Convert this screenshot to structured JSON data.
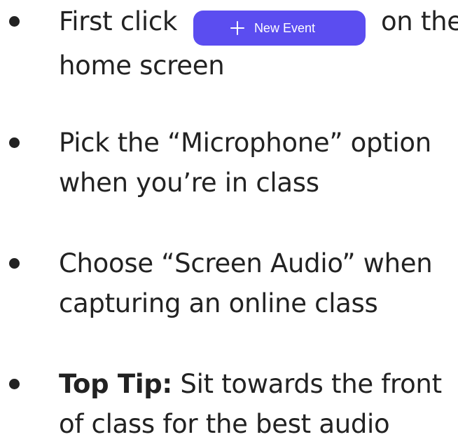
{
  "instructions": [
    {
      "line1_before_button": "First click",
      "button_label": "New Event",
      "line1_after_button": "on the",
      "line2": "home screen"
    },
    {
      "line1": "Pick the “Microphone” option",
      "line2": "when you’re in class"
    },
    {
      "line1": "Choose “Screen Audio” when",
      "line2": "capturing an online class"
    },
    {
      "label": "Top Tip:",
      "line1_rest": " Sit towards the front",
      "line2": "of class for the best audio"
    }
  ],
  "colors": {
    "button_background": "#5b4df0",
    "text": "#222222"
  },
  "icons": {
    "button_icon": "plus-icon"
  }
}
